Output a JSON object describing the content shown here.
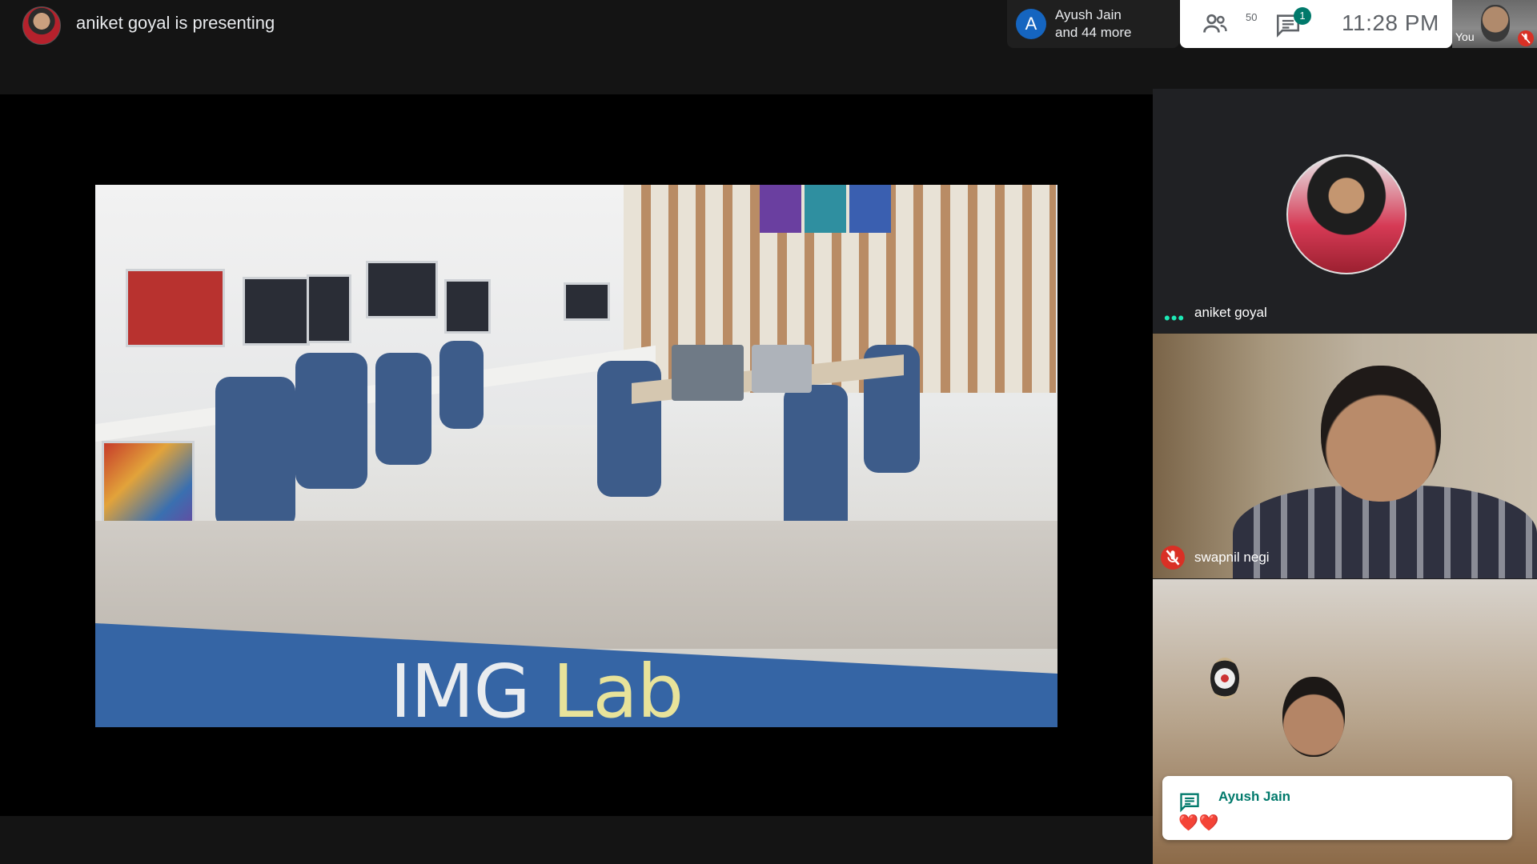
{
  "header": {
    "presenting_text": "aniket goyal is presenting"
  },
  "participants_chip": {
    "avatar_letter": "A",
    "name": "Ayush Jain",
    "more": "and 44 more"
  },
  "controls": {
    "people_count": "50",
    "chat_badge": "1",
    "clock": "11:28  PM"
  },
  "self_view": {
    "label": "You"
  },
  "slide": {
    "caption_main": "IMG",
    "caption_accent": "Lab"
  },
  "tiles": [
    {
      "name": "aniket goyal",
      "speaking": true
    },
    {
      "name": "swapnil negi",
      "muted": true
    },
    {
      "name": "Ayush Jain"
    }
  ],
  "chat_toast": {
    "sender": "Ayush Jain",
    "message": "❤️❤️"
  },
  "colors": {
    "accent_teal": "#00796b",
    "mute_red": "#d93025",
    "participant_blue": "#1565c0",
    "speaking_dots": "#1de9b6"
  },
  "icons": [
    "people-icon",
    "chat-icon",
    "mic-off-icon",
    "speaking-dots-icon"
  ]
}
